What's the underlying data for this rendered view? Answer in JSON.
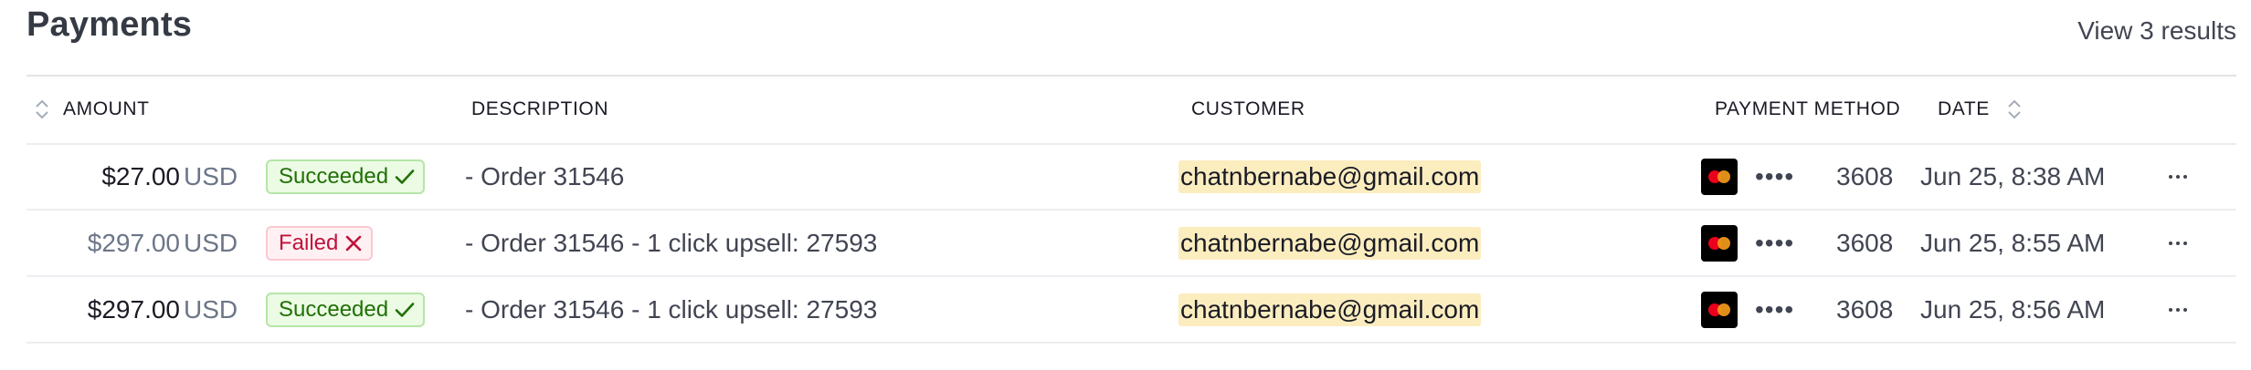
{
  "header": {
    "title": "Payments",
    "view_results_label": "View 3 results"
  },
  "table": {
    "columns": {
      "amount": "AMOUNT",
      "description": "DESCRIPTION",
      "customer": "CUSTOMER",
      "payment_method": "PAYMENT METHOD",
      "date": "DATE"
    },
    "rows": [
      {
        "amount": "$27.00",
        "currency": "USD",
        "status": "Succeeded",
        "status_type": "succeeded",
        "description": "- Order 31546",
        "customer": "chatnbernabe@gmail.com",
        "card_brand_icon": "mastercard-icon",
        "card_mask": "••••",
        "card_last4": "3608",
        "date": "Jun 25, 8:38 AM"
      },
      {
        "amount": "$297.00",
        "currency": "USD",
        "status": "Failed",
        "status_type": "failed",
        "description": "- Order 31546 - 1 click upsell: 27593",
        "customer": "chatnbernabe@gmail.com",
        "card_brand_icon": "mastercard-icon",
        "card_mask": "••••",
        "card_last4": "3608",
        "date": "Jun 25, 8:55 AM"
      },
      {
        "amount": "$297.00",
        "currency": "USD",
        "status": "Succeeded",
        "status_type": "succeeded",
        "description": "- Order 31546 - 1 click upsell: 27593",
        "customer": "chatnbernabe@gmail.com",
        "card_brand_icon": "mastercard-icon",
        "card_mask": "••••",
        "card_last4": "3608",
        "date": "Jun 25, 8:56 AM"
      }
    ]
  },
  "colors": {
    "succeeded_text": "#217005",
    "succeeded_bg": "#ebfbe4",
    "failed_text": "#c0123c",
    "failed_bg": "#fff1f3",
    "email_highlight": "#fcedbf"
  }
}
